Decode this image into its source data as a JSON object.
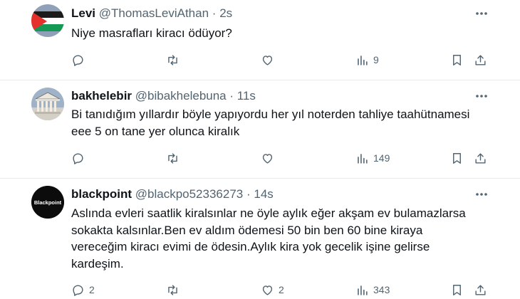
{
  "tweets": [
    {
      "name": "Levi",
      "handle": "@ThomasLeviAthan",
      "dot": "·",
      "time": "2s",
      "avatar": "palestine-flag-avatar",
      "lines": [
        "Niye masrafları kiracı ödüyor?"
      ],
      "reply_count": "",
      "like_count": "",
      "views": "9"
    },
    {
      "name": "bakhelebir",
      "handle": "@bibakhelebuna",
      "dot": "·",
      "time": "11s",
      "avatar": "building-columns-avatar",
      "lines": [
        "Bi tanıdığım yıllardır böyle yapıyordu her yıl noterden tahliye taahütnamesi",
        "eee 5 on tane yer olunca kiralık"
      ],
      "reply_count": "",
      "like_count": "",
      "views": "149"
    },
    {
      "name": "blackpoint",
      "handle": "@blackpo52336273",
      "dot": "·",
      "time": "14s",
      "avatar": "blackpoint-logo-avatar",
      "avatar_text": "Blackpoint",
      "lines": [
        "Aslında evleri saatlik kiralsınlar ne öyle aylık eğer akşam ev bulamazlarsa",
        "sokakta kalsınlar.Ben ev aldım ödemesi 50 bin ben 60 bine kiraya",
        "vereceğim kiracı evimi de ödesin.Aylık kira yok gecelik işine gelirse",
        "kardeşim."
      ],
      "reply_count": "2",
      "like_count": "2",
      "views": "343"
    }
  ],
  "colors": {
    "text": "#0f1419",
    "secondary": "#536471",
    "divider": "#e7e9ea"
  }
}
